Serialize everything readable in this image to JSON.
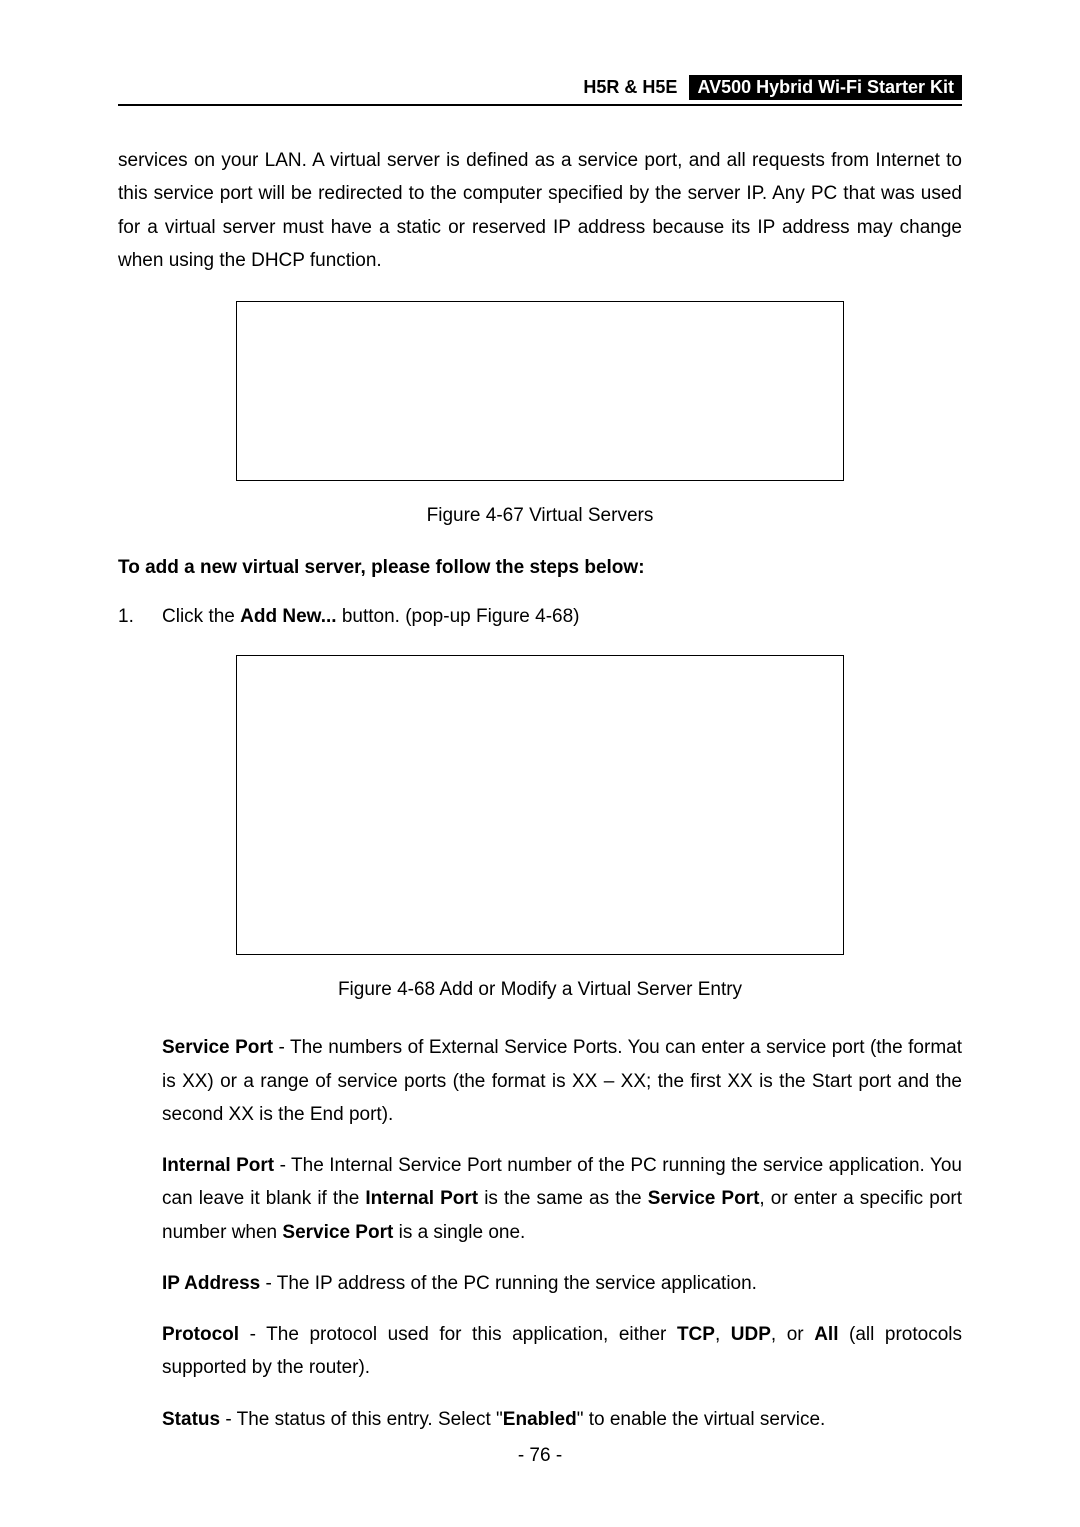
{
  "header": {
    "model": "H5R & H5E",
    "product": "AV500 Hybrid Wi-Fi Starter Kit"
  },
  "intro_paragraph": "services on your LAN. A virtual server is defined as a service port, and all requests from Internet to this service port will be redirected to the computer specified by the server IP. Any PC that was used for a virtual server must have a static or reserved IP address because its IP address may change when using the DHCP function.",
  "figure1_caption": "Figure 4-67 Virtual Servers",
  "step_heading": "To add a new virtual server, please follow the steps below:",
  "step1": {
    "num": "1.",
    "prefix": "Click the ",
    "bold": "Add New...",
    "suffix": " button. (pop-up Figure 4-68)"
  },
  "figure2_caption": "Figure 4-68 Add or Modify a Virtual Server Entry",
  "defs": {
    "service_port": {
      "label": "Service Port",
      "text": " - The numbers of External Service Ports. You can enter a service port (the format is XX) or a range of service ports (the format is XX – XX; the first XX is the Start port and the second XX is the End port)."
    },
    "internal_port": {
      "label": "Internal Port",
      "text_a": " - The Internal Service Port number of the PC running the service application. You can leave it blank if the ",
      "bold_a": "Internal Port",
      "text_b": " is the same as the ",
      "bold_b": "Service Port",
      "text_c": ", or enter a specific port number when ",
      "bold_c": "Service Port",
      "text_d": " is a single one."
    },
    "ip_address": {
      "label": "IP Address",
      "text": " - The IP address of the PC running the service application."
    },
    "protocol": {
      "label": "Protocol",
      "text_a": " - The protocol used for this application, either ",
      "bold_a": "TCP",
      "text_b": ", ",
      "bold_b": "UDP",
      "text_c": ", or ",
      "bold_c": "All",
      "text_d": " (all protocols supported by the router)."
    },
    "status": {
      "label": "Status",
      "text_a": " - The status of this entry. Select \"",
      "bold_a": "Enabled",
      "text_b": "\" to enable the virtual service."
    }
  },
  "page_number": "- 76 -"
}
